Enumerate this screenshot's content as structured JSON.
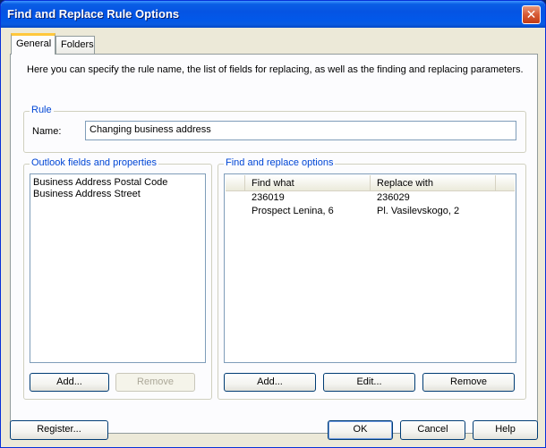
{
  "window": {
    "title": "Find and Replace Rule Options",
    "close_glyph": "✕"
  },
  "tabs": [
    {
      "label": "General"
    },
    {
      "label": "Folders"
    }
  ],
  "description": "Here you can specify the rule name, the list of fields for replacing, as well as the finding and replacing parameters.",
  "rule": {
    "group_title": "Rule",
    "name_label": "Name:",
    "name_value": "Changing business address"
  },
  "fields": {
    "group_title": "Outlook fields and properties",
    "items": [
      "Business Address Postal Code",
      "Business Address Street"
    ],
    "add_label": "Add...",
    "remove_label": "Remove"
  },
  "find_replace": {
    "group_title": "Find and replace options",
    "columns": [
      "Find what",
      "Replace with"
    ],
    "rows": [
      {
        "find": "236019",
        "replace": "236029"
      },
      {
        "find": "Prospect Lenina, 6",
        "replace": "Pl. Vasilevskogo, 2"
      }
    ],
    "add_label": "Add...",
    "edit_label": "Edit...",
    "remove_label": "Remove"
  },
  "footer": {
    "register_label": "Register...",
    "ok_label": "OK",
    "cancel_label": "Cancel",
    "help_label": "Help"
  },
  "colors": {
    "titlebar": "#0554e3",
    "group_title": "#0046d5",
    "dialog_bg": "#ece9d8"
  }
}
